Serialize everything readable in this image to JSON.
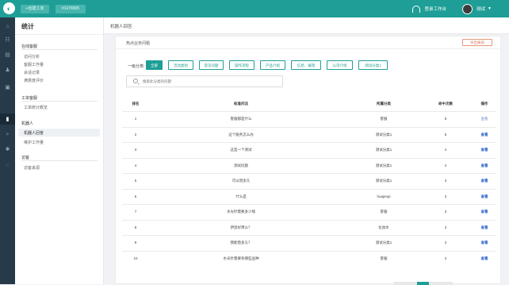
{
  "topbar": {
    "btn1": "+创建工单",
    "btn2": "#1478905",
    "workbench": "登录工作台",
    "user": "测试"
  },
  "sidebar": {
    "title": "统计",
    "sections": [
      {
        "label": "在线客服",
        "items": [
          "访问分析",
          "客服工作量",
          "会话记录",
          "满意度评价"
        ]
      },
      {
        "label": "工单客服",
        "items": [
          "工单统计概览"
        ]
      },
      {
        "label": "机器人",
        "items": [
          "机器人回答",
          "维护工作量"
        ]
      },
      {
        "label": "访客",
        "items": [
          "访客来源"
        ]
      }
    ]
  },
  "breadcrumb": "机器人回答",
  "card": {
    "title": "热点业务问题",
    "export": "导出报表"
  },
  "filter": {
    "label": "一级分类:",
    "chips": [
      "全部",
      "活动类别",
      "常见问题",
      "操作流程",
      "产品介绍",
      "信息、报错",
      "公司介绍",
      "测试分类1"
    ],
    "search_placeholder": "搜索此分类的问题"
  },
  "table": {
    "headers": [
      "排名",
      "标准问法",
      "所属分类",
      "命中次数",
      "操作"
    ],
    "rows": [
      {
        "rank": "1",
        "question": "客服都是什么",
        "category": "客服",
        "hits": "6",
        "action": "查看"
      },
      {
        "rank": "2",
        "question": "这个服务怎么办",
        "category": "测试分类1",
        "hits": "5",
        "action": "查看"
      },
      {
        "rank": "3",
        "question": "这是一个测试",
        "category": "测试分类1",
        "hits": "4",
        "action": "查看"
      },
      {
        "rank": "4",
        "question": "测试问题",
        "category": "测试分类1",
        "hits": "4",
        "action": "查看"
      },
      {
        "rank": "5",
        "question": "可以借多久",
        "category": "测试分类1",
        "hits": "3",
        "action": "查看"
      },
      {
        "rank": "6",
        "question": "什么是",
        "category": "huajenpi",
        "hits": "3",
        "action": "查看"
      },
      {
        "rank": "7",
        "question": "水光针需要多少钱",
        "category": "客服",
        "hits": "3",
        "action": "查看"
      },
      {
        "rank": "8",
        "question": "伊思好用么？",
        "category": "化妆水",
        "hits": "3",
        "action": "查看"
      },
      {
        "rank": "9",
        "question": "我能借多久？",
        "category": "测试分类1",
        "hits": "3",
        "action": "查看"
      },
      {
        "rank": "10",
        "question": "水光针需要有哪些品种",
        "category": "客服",
        "hits": "3",
        "action": "查看"
      }
    ]
  },
  "colors": {
    "brand": "#1e9e96",
    "nav": "#263a4a",
    "link": "#3366cc",
    "export": "#e07a55"
  },
  "nav_icons": [
    "home-icon",
    "grid-icon",
    "document-icon",
    "user-icon",
    "lock-icon",
    "chart-icon",
    "search-icon",
    "gear-icon",
    "circle-icon"
  ]
}
